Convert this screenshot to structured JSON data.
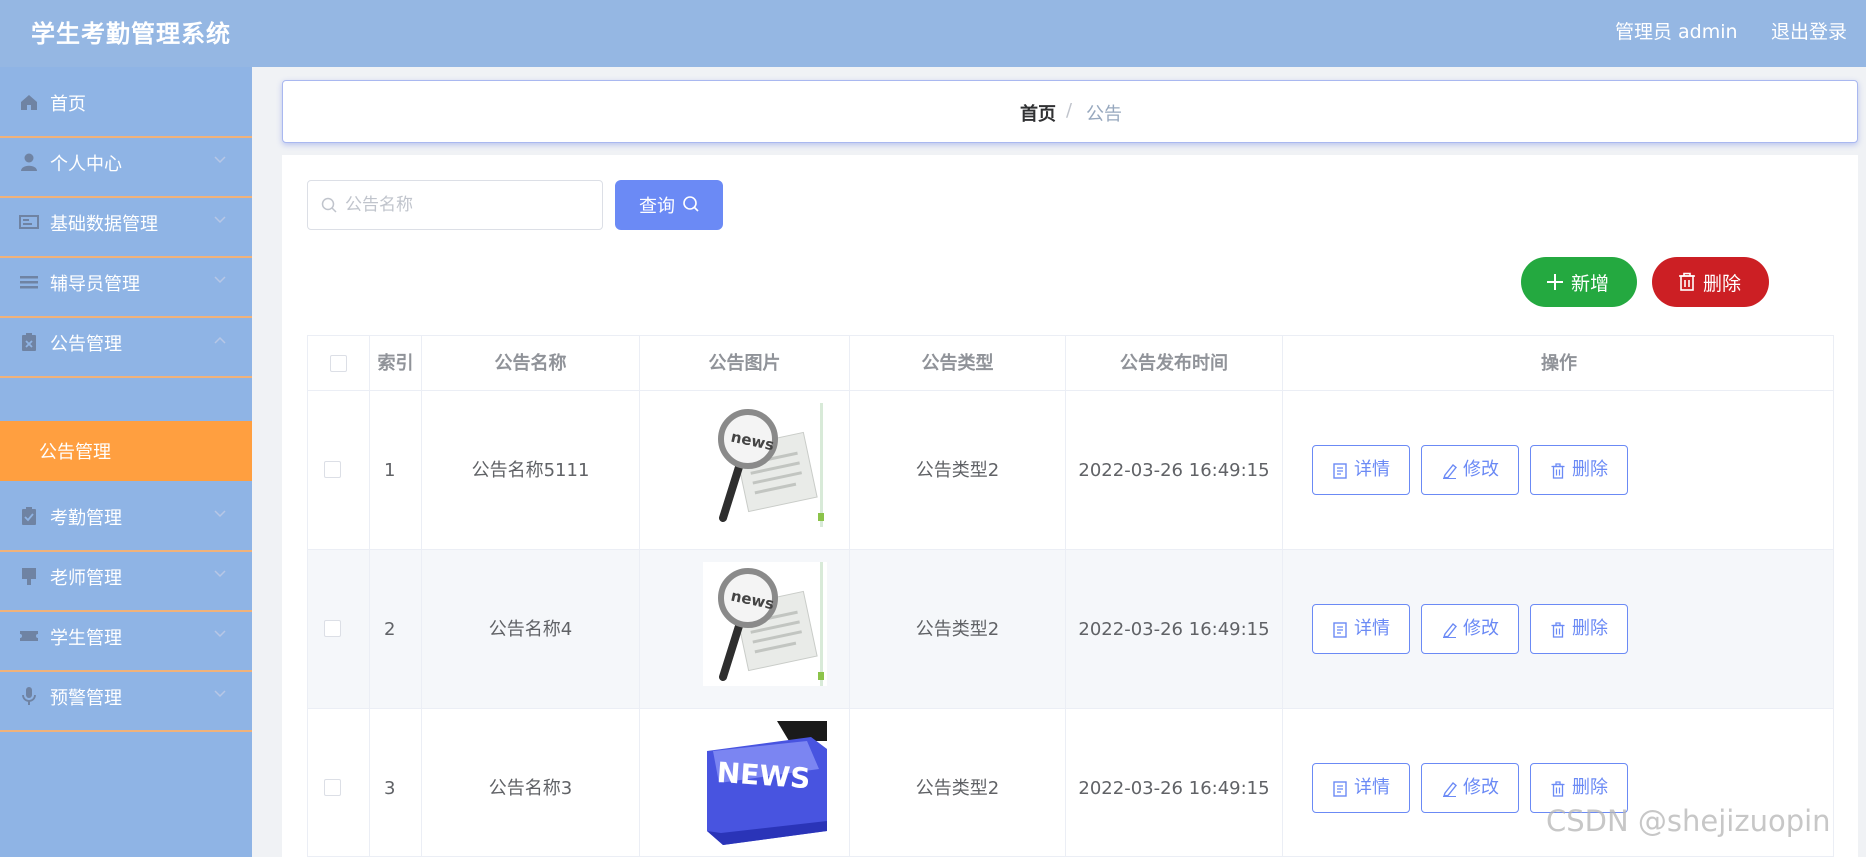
{
  "header": {
    "title": "学生考勤管理系统",
    "user": "管理员 admin",
    "logout": "退出登录"
  },
  "sidebar": {
    "items": [
      {
        "label": "首页",
        "icon": "home-icon",
        "expandable": false
      },
      {
        "label": "个人中心",
        "icon": "user-icon",
        "expandable": true
      },
      {
        "label": "基础数据管理",
        "icon": "id-card-icon",
        "expandable": true
      },
      {
        "label": "辅导员管理",
        "icon": "menu-icon",
        "expandable": true
      },
      {
        "label": "公告管理",
        "icon": "clipboard-x-icon",
        "expandable": true,
        "expanded": true
      },
      {
        "label": "考勤管理",
        "icon": "clipboard-check-icon",
        "expandable": true
      },
      {
        "label": "老师管理",
        "icon": "brush-icon",
        "expandable": true
      },
      {
        "label": "学生管理",
        "icon": "ticket-icon",
        "expandable": true
      },
      {
        "label": "预警管理",
        "icon": "microphone-icon",
        "expandable": true
      }
    ],
    "submenu_active": "公告管理",
    "active_color": "#ff9f40"
  },
  "breadcrumb": {
    "home": "首页",
    "separator": "/",
    "current": "公告"
  },
  "search": {
    "placeholder": "公告名称",
    "value": "",
    "button": "查询"
  },
  "actions": {
    "add": "新增",
    "delete": "删除"
  },
  "table": {
    "columns": [
      "索引",
      "公告名称",
      "公告图片",
      "公告类型",
      "公告发布时间",
      "操作"
    ],
    "rows": [
      {
        "index": "1",
        "name": "公告名称5111",
        "image": "news-magnifier-image",
        "type": "公告类型2",
        "time": "2022-03-26 16:49:15"
      },
      {
        "index": "2",
        "name": "公告名称4",
        "image": "news-magnifier-image",
        "type": "公告类型2",
        "time": "2022-03-26 16:49:15"
      },
      {
        "index": "3",
        "name": "公告名称3",
        "image": "news-key-image",
        "type": "公告类型2",
        "time": "2022-03-26 16:49:15"
      }
    ],
    "row_actions": {
      "detail": "详情",
      "edit": "修改",
      "delete": "删除"
    }
  },
  "colors": {
    "header": "#95b7e3",
    "sidebar": "#8fb4e5",
    "primary": "#6b8af5",
    "success": "#24a940",
    "danger": "#cc1f24"
  },
  "watermark": "CSDN @shejizuopin"
}
